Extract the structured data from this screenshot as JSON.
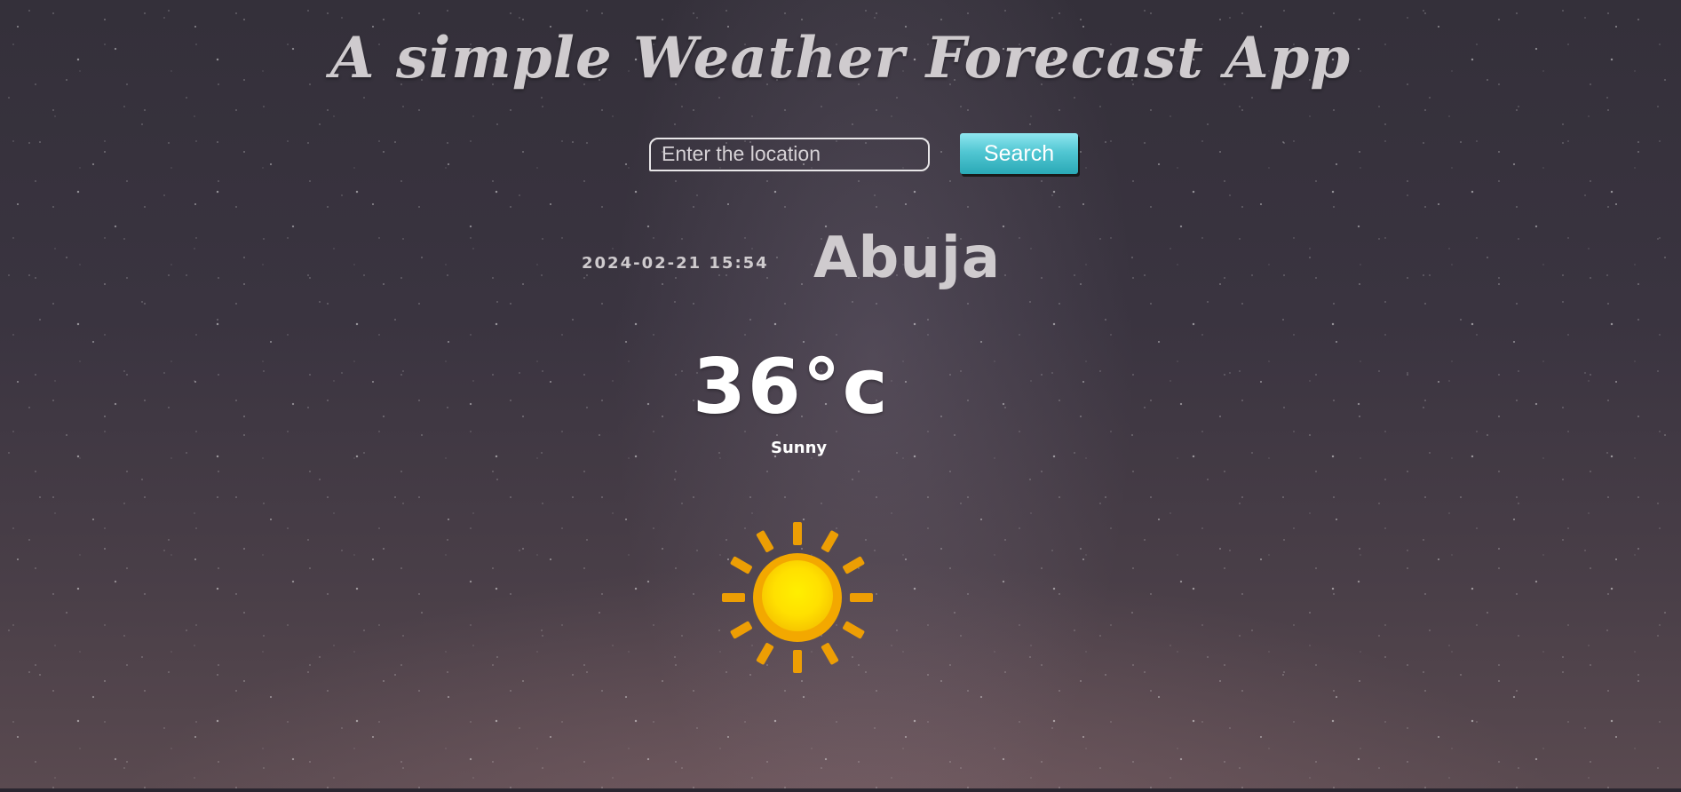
{
  "app": {
    "title": "A simple Weather Forecast App"
  },
  "search": {
    "placeholder": "Enter the location",
    "value": "",
    "button_label": "Search",
    "button_color": "#52c7d3"
  },
  "weather": {
    "datetime": "2024-02-21 15:54",
    "city": "Abuja",
    "temperature": "36°c",
    "condition": "Sunny",
    "icon": "sun-icon"
  }
}
